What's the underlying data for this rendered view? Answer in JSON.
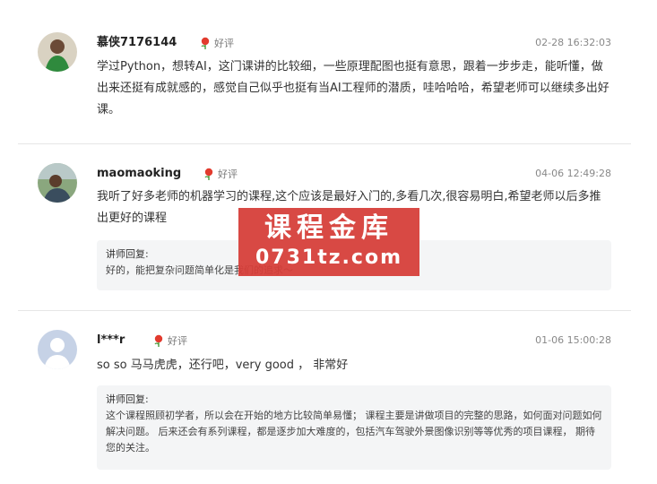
{
  "reviews": [
    {
      "username": "慕侠7176144",
      "rating_label": "好评",
      "time": "02-28 16:32:03",
      "content": "学过Python，想转AI，这门课讲的比较细，一些原理配图也挺有意思，跟着一步步走，能听懂，做出来还挺有成就感的，感觉自己似乎也挺有当AI工程师的潜质，哇哈哈哈，希望老师可以继续多出好课。"
    },
    {
      "username": "maomaoking",
      "rating_label": "好评",
      "time": "04-06 12:49:28",
      "content": "我听了好多老师的机器学习的课程,这个应该是最好入门的,多看几次,很容易明白,希望老师以后多推出更好的课程",
      "reply_title": "讲师回复:",
      "reply_text": "好的，能把复杂问题简单化是我们的追求～"
    },
    {
      "username": "l***r",
      "rating_label": "好评",
      "time": "01-06 15:00:28",
      "content": "so so 马马虎虎，还行吧，very good ， 非常好",
      "reply_title": "讲师回复:",
      "reply_text": "这个课程照顾初学者，所以会在开始的地方比较简单易懂； 课程主要是讲做项目的完整的思路，如何面对问题如何解决问题。 后来还会有系列课程，都是逐步加大难度的，包括汽车驾驶外景图像识别等等优秀的项目课程， 期待您的关注。"
    }
  ],
  "watermark": {
    "title": "课程金库",
    "subtitle": "0731tz.com"
  },
  "colors": {
    "watermark_bg": "#d63e38",
    "reply_bg": "#f4f5f6",
    "rating_flower": "#e23b2e"
  }
}
